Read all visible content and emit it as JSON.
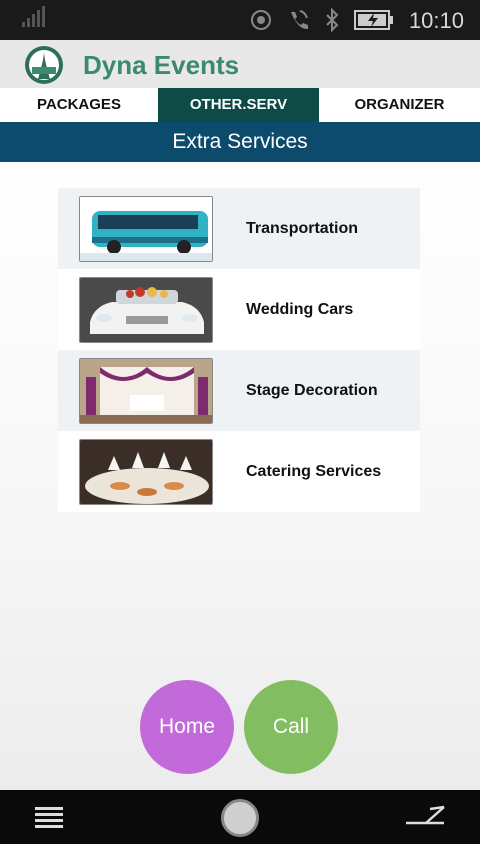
{
  "status_bar": {
    "time": "10:10"
  },
  "app": {
    "title": "Dyna Events"
  },
  "tabs": [
    {
      "label": "PACKAGES",
      "active": false
    },
    {
      "label": "OTHER.SERV",
      "active": true
    },
    {
      "label": "ORGANIZER",
      "active": false
    }
  ],
  "section": {
    "title": "Extra Services"
  },
  "services": [
    {
      "label": "Transportation",
      "image": "bus-image"
    },
    {
      "label": "Wedding Cars",
      "image": "wedding-car-image"
    },
    {
      "label": "Stage Decoration",
      "image": "stage-decoration-image"
    },
    {
      "label": "Catering Services",
      "image": "catering-image"
    }
  ],
  "buttons": {
    "home": "Home",
    "call": "Call"
  },
  "colors": {
    "title_green": "#3c8a6c",
    "tab_active": "#0e4a46",
    "section_bar": "#0d4b6c",
    "home_button": "#c26ad9",
    "call_button": "#82bd62"
  }
}
